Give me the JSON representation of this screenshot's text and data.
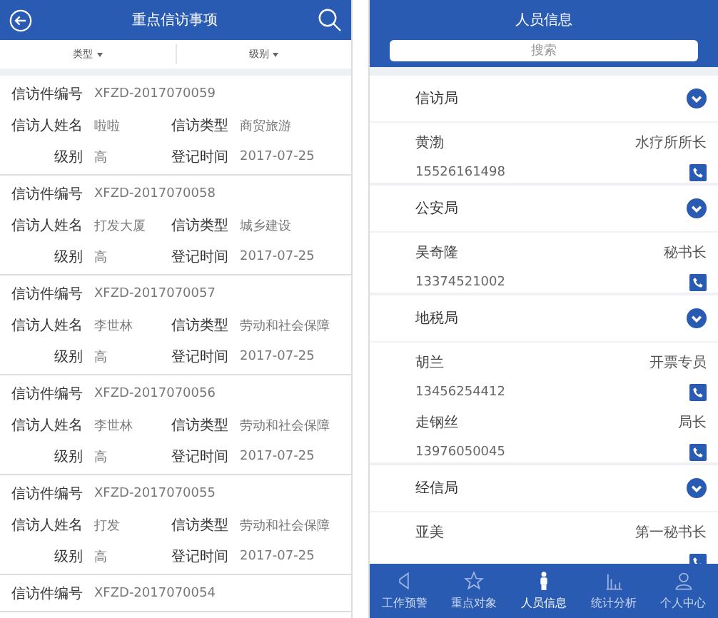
{
  "left": {
    "header": {
      "title": "重点信访事项"
    },
    "filters": [
      {
        "label": "类型"
      },
      {
        "label": "级别"
      }
    ],
    "records": [
      {
        "rows": [
          [
            {
              "label": "信访件编号",
              "value": "XFZD-2017070059"
            }
          ],
          [
            {
              "label": "信访人姓名",
              "value": "啦啦"
            },
            {
              "label": "信访类型",
              "value": "商贸旅游"
            }
          ],
          [
            {
              "label": "级别",
              "value": "高"
            },
            {
              "label": "登记时间",
              "value": "2017-07-25"
            }
          ]
        ]
      },
      {
        "rows": [
          [
            {
              "label": "信访件编号",
              "value": "XFZD-2017070058"
            }
          ],
          [
            {
              "label": "信访人姓名",
              "value": "打发大厦"
            },
            {
              "label": "信访类型",
              "value": "城乡建设"
            }
          ],
          [
            {
              "label": "级别",
              "value": "高"
            },
            {
              "label": "登记时间",
              "value": "2017-07-25"
            }
          ]
        ]
      },
      {
        "rows": [
          [
            {
              "label": "信访件编号",
              "value": "XFZD-2017070057"
            }
          ],
          [
            {
              "label": "信访人姓名",
              "value": "李世林"
            },
            {
              "label": "信访类型",
              "value": "劳动和社会保障"
            }
          ],
          [
            {
              "label": "级别",
              "value": "高"
            },
            {
              "label": "登记时间",
              "value": "2017-07-25"
            }
          ]
        ]
      },
      {
        "rows": [
          [
            {
              "label": "信访件编号",
              "value": "XFZD-2017070056"
            }
          ],
          [
            {
              "label": "信访人姓名",
              "value": "李世林"
            },
            {
              "label": "信访类型",
              "value": "劳动和社会保障"
            }
          ],
          [
            {
              "label": "级别",
              "value": "高"
            },
            {
              "label": "登记时间",
              "value": "2017-07-25"
            }
          ]
        ]
      },
      {
        "rows": [
          [
            {
              "label": "信访件编号",
              "value": "XFZD-2017070055"
            }
          ],
          [
            {
              "label": "信访人姓名",
              "value": "打发"
            },
            {
              "label": "信访类型",
              "value": "劳动和社会保障"
            }
          ],
          [
            {
              "label": "级别",
              "value": "高"
            },
            {
              "label": "登记时间",
              "value": "2017-07-25"
            }
          ]
        ]
      },
      {
        "rows": [
          [
            {
              "label": "信访件编号",
              "value": "XFZD-2017070054"
            }
          ]
        ]
      }
    ]
  },
  "right": {
    "header": {
      "title": "人员信息"
    },
    "search": {
      "placeholder": "搜索"
    },
    "groups": [
      {
        "name": "信访局",
        "expanded": true,
        "contacts": [
          {
            "name": "黄渤",
            "title": "水疗所所长",
            "phone": "15526161498"
          }
        ]
      },
      {
        "name": "公安局",
        "expanded": true,
        "contacts": [
          {
            "name": "吴奇隆",
            "title": "秘书长",
            "phone": "13374521002"
          }
        ]
      },
      {
        "name": "地税局",
        "expanded": true,
        "contacts": [
          {
            "name": "胡兰",
            "title": "开票专员",
            "phone": "13456254412"
          },
          {
            "name": "走钢丝",
            "title": "局长",
            "phone": "13976050045"
          }
        ]
      },
      {
        "name": "经信局",
        "expanded": true,
        "contacts": [
          {
            "name": "亚美",
            "title": "第一秘书长"
          }
        ]
      }
    ],
    "tabs": [
      {
        "label": "工作预警",
        "kind": "warning",
        "selected": false
      },
      {
        "label": "重点对象",
        "kind": "star",
        "selected": false
      },
      {
        "label": "人员信息",
        "kind": "person",
        "selected": true
      },
      {
        "label": "统计分析",
        "kind": "chart",
        "selected": false
      },
      {
        "label": "个人中心",
        "kind": "user",
        "selected": false
      }
    ]
  }
}
